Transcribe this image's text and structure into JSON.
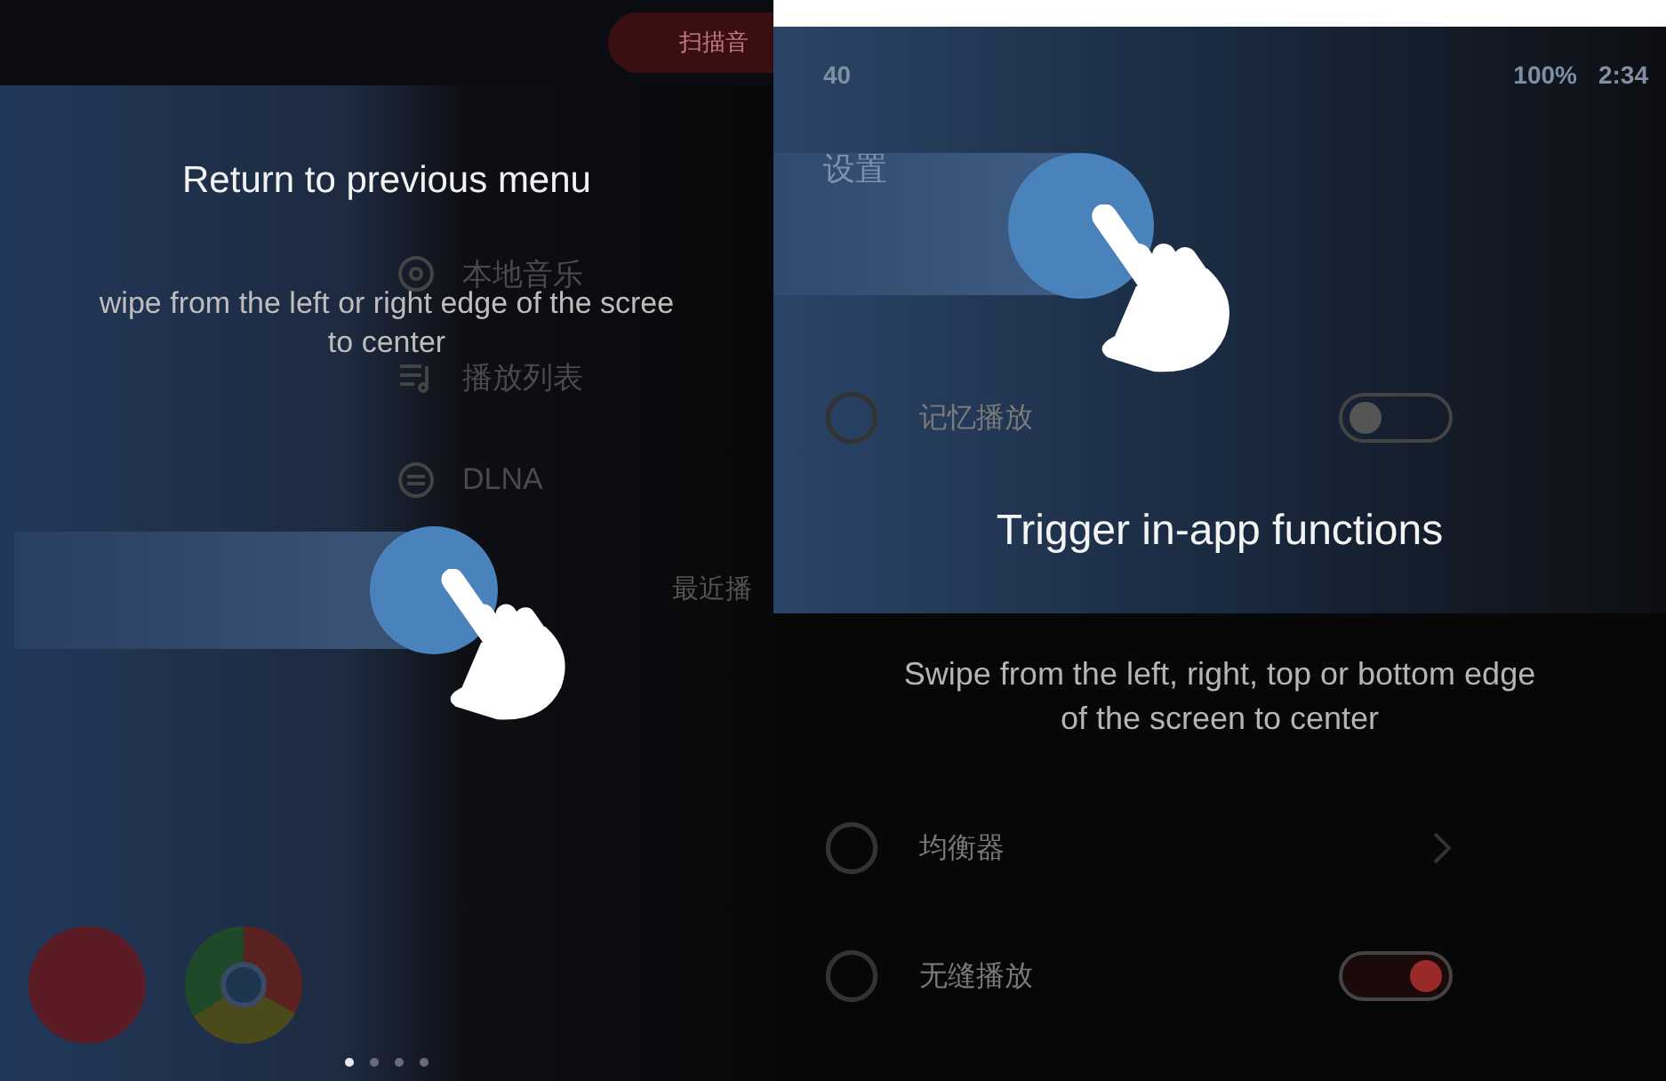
{
  "left_panel": {
    "top_button": "扫描音",
    "menu_items": [
      {
        "label": "本地音乐"
      },
      {
        "label": "播放列表"
      },
      {
        "label": "DLNA"
      }
    ],
    "recent_title": "最近播",
    "title": "Return to previous menu",
    "description": [
      "wipe from the left or right edge of the scree",
      "to center"
    ],
    "page_dots": [
      {
        "selected": true
      },
      {
        "selected": false
      },
      {
        "selected": false
      },
      {
        "selected": false
      }
    ]
  },
  "right_panel": {
    "status_bar": {
      "volume": "40",
      "battery": "100%",
      "time": "2:34"
    },
    "screen_title": "设置",
    "settings": [
      {
        "label": "记忆播放",
        "kind": "toggle",
        "on": false
      },
      {
        "label": "均衡器",
        "kind": "link"
      },
      {
        "label": "无缝播放",
        "kind": "toggle",
        "on": true
      }
    ],
    "title": "Trigger in-app functions",
    "description": [
      "Swipe from the left, right, top or bottom edge",
      "of the screen to center"
    ]
  }
}
